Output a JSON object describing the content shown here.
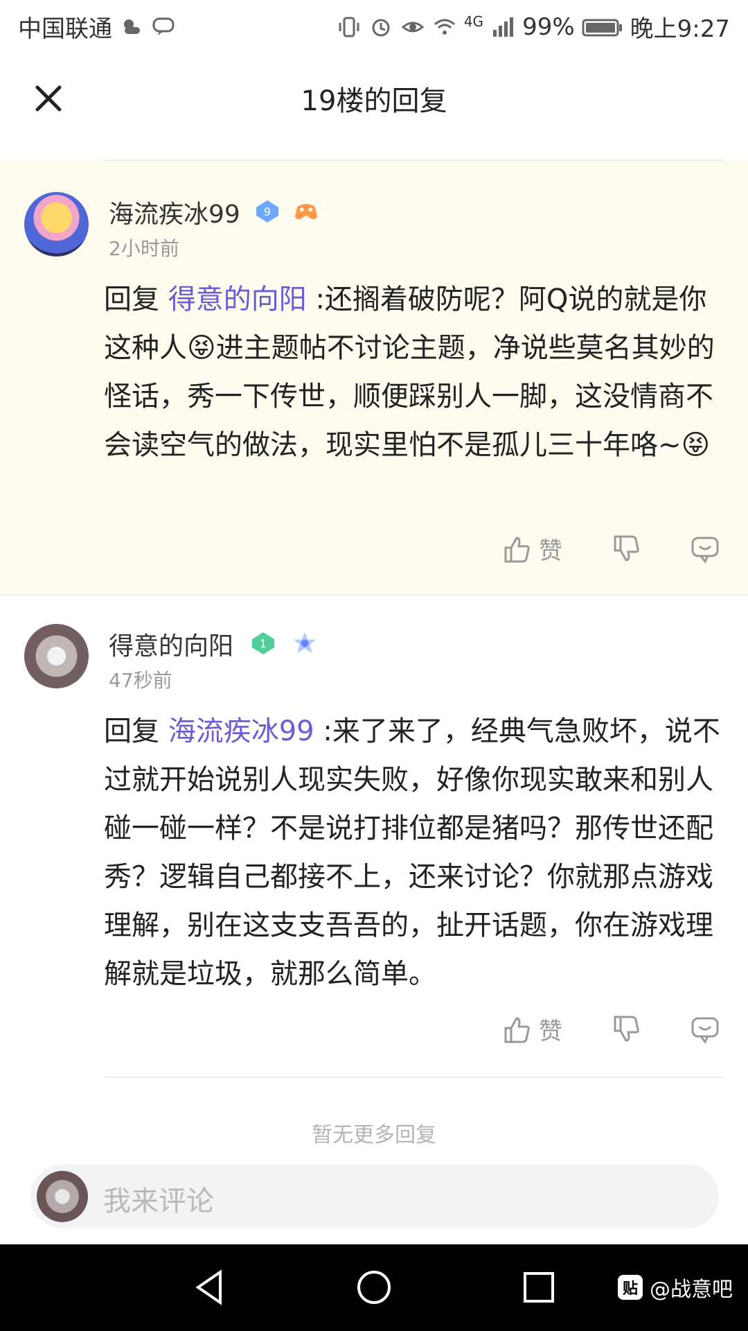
{
  "status_bar": {
    "carrier": "中国联通",
    "battery": "99%",
    "time": "晚上9:27",
    "network": "4G"
  },
  "header": {
    "title": "19楼的回复"
  },
  "replies": [
    {
      "username": "海流疾冰99",
      "level_badge": "9",
      "time": "2小时前",
      "reply_prefix": "回复",
      "reply_to": "得意的向阳",
      "content": ":还搁着破防呢？阿Q说的就是你这种人😝进主题帖不讨论主题，净说些莫名其妙的怪话，秀一下传世，顺便踩别人一脚，这没情商不会读空气的做法，现实里怕不是孤儿三十年咯~😝",
      "like_label": "赞"
    },
    {
      "username": "得意的向阳",
      "level_badge": "1",
      "time": "47秒前",
      "reply_prefix": "回复",
      "reply_to": "海流疾冰99",
      "content": ":来了来了，经典气急败坏，说不过就开始说别人现实失败，好像你现实敢来和别人碰一碰一样？不是说打排位都是猪吗？那传世还配秀？逻辑自己都接不上，还来讨论？你就那点游戏理解，别在这支支吾吾的，扯开话题，你在游戏理解就是垃圾，就那么简单。",
      "like_label": "赞"
    }
  ],
  "no_more_text": "暂无更多回复",
  "composer": {
    "placeholder": "我来评论"
  },
  "watermark": {
    "logo_text": "贴",
    "text": "@战意吧"
  }
}
